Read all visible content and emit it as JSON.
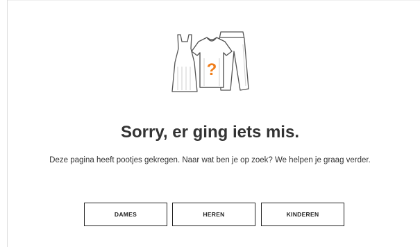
{
  "error": {
    "title": "Sorry, er ging iets mis.",
    "message": "Deze pagina heeft pootjes gekregen. Naar wat ben je op zoek? We helpen je graag verder.",
    "illustration_symbol": "?"
  },
  "buttons": {
    "women": "DAMES",
    "men": "HEREN",
    "kids": "KINDEREN"
  },
  "colors": {
    "text": "#333333",
    "accent": "#f07d1a",
    "button_border": "#222222",
    "illustration_line": "#555555"
  }
}
